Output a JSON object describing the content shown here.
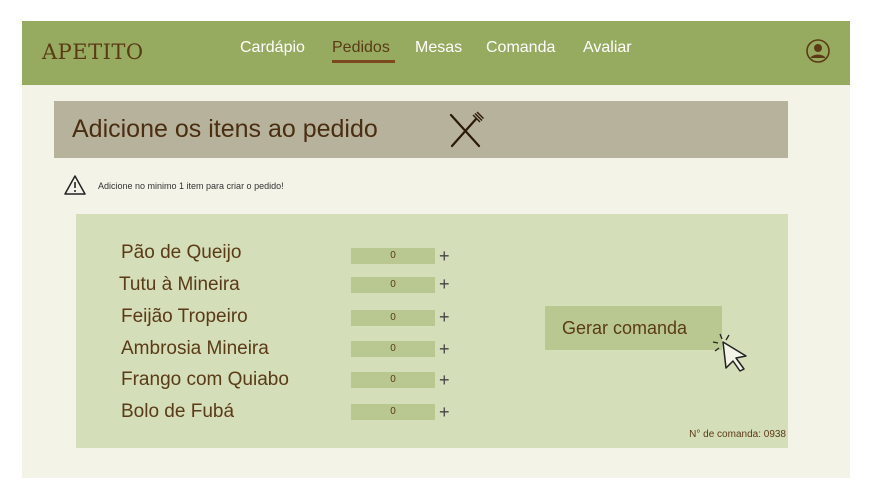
{
  "brand": "APETITO",
  "nav": {
    "items": [
      {
        "label": "Cardápio"
      },
      {
        "label": "Pedidos"
      },
      {
        "label": "Mesas"
      },
      {
        "label": "Comanda"
      },
      {
        "label": "Avaliar"
      }
    ],
    "active": "Pedidos"
  },
  "header": {
    "title": "Adicione os itens ao pedido",
    "icon": "fork-knife-icon"
  },
  "alert": {
    "icon": "warning-icon",
    "text": "Adicione no minimo 1 item para criar o pedido!"
  },
  "items": [
    {
      "name": "Pão de Queijo",
      "qty": "0"
    },
    {
      "name": "Tutu à Mineira",
      "qty": "0"
    },
    {
      "name": "Feijão Tropeiro",
      "qty": "0"
    },
    {
      "name": "Ambrosia Mineira",
      "qty": "0"
    },
    {
      "name": "Frango com Quiabo",
      "qty": "0"
    },
    {
      "name": "Bolo de Fubá",
      "qty": "0"
    }
  ],
  "plus_label": "+",
  "button": {
    "label": "Gerar comanda"
  },
  "order_number": "N° de comanda: 0938",
  "colors": {
    "navbar": "#96ab60",
    "brand_text": "#5b3a16",
    "header_bar": "#b7b29b",
    "panel": "#d4deb9",
    "qty_box": "#b9c890",
    "background": "#f3f3e8"
  }
}
